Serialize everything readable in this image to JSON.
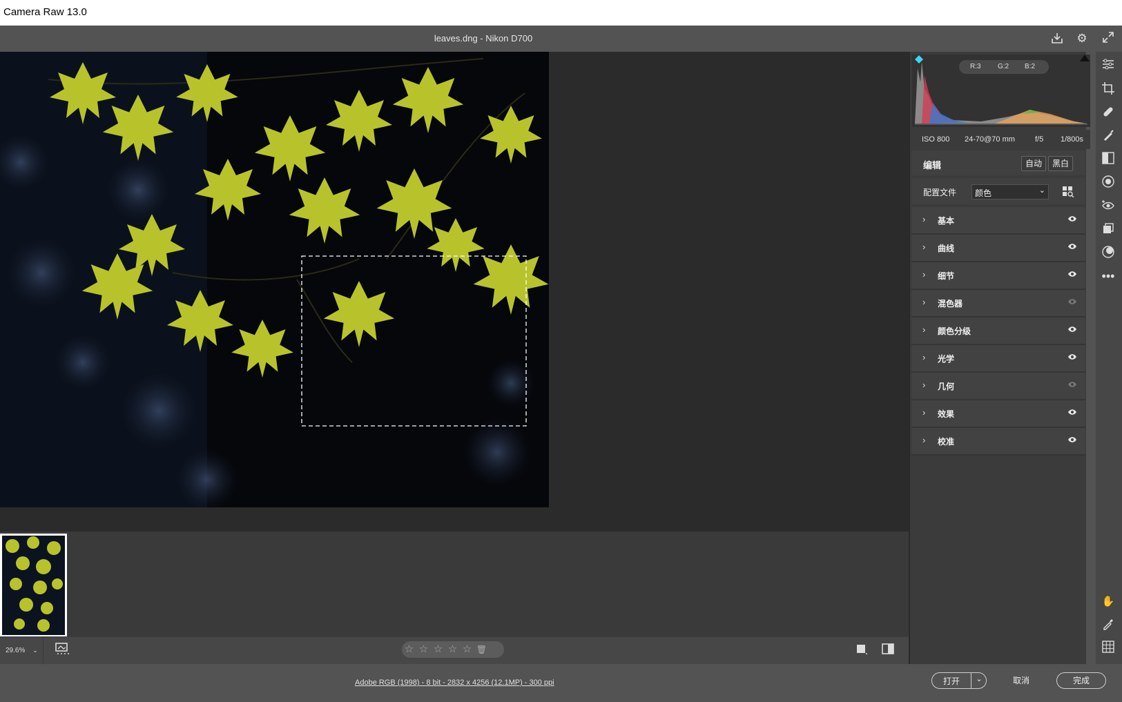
{
  "window": {
    "title": "Camera Raw 13.0"
  },
  "header": {
    "file_title": "leaves.dng  -  Nikon D700",
    "icons": [
      "save-icon",
      "settings-gear-icon",
      "fullscreen-icon"
    ]
  },
  "histogram": {
    "r": "R:3",
    "g": "G:2",
    "b": "B:2"
  },
  "exif": {
    "iso": "ISO 800",
    "lens": "24-70@70 mm",
    "aperture": "f/5",
    "shutter": "1/800s"
  },
  "edit": {
    "title": "编辑",
    "auto": "自动",
    "bw": "黑白",
    "profile_label": "配置文件",
    "profile_value": "颜色"
  },
  "sections": [
    {
      "label": "基本",
      "visible": true
    },
    {
      "label": "曲线",
      "visible": true
    },
    {
      "label": "细节",
      "visible": true
    },
    {
      "label": "混色器",
      "visible": false
    },
    {
      "label": "颜色分级",
      "visible": true
    },
    {
      "label": "光学",
      "visible": true
    },
    {
      "label": "几何",
      "visible": false
    },
    {
      "label": "效果",
      "visible": true
    },
    {
      "label": "校准",
      "visible": true
    }
  ],
  "toolbar": {
    "zoom": "29.6%",
    "stars": [
      "☆",
      "☆",
      "☆",
      "☆",
      "☆"
    ],
    "trash": "🗑"
  },
  "status": {
    "image_info": "Adobe RGB (1998) - 8 bit - 2832 x 4256 (12.1MP) - 300 ppi",
    "open": "打开",
    "cancel": "取消",
    "done": "完成"
  },
  "colors": {
    "accent": "#2ec7e0",
    "panel": "#3b3b3b",
    "canvas": "#2b2b2b",
    "leaf": "#b9c62a"
  }
}
